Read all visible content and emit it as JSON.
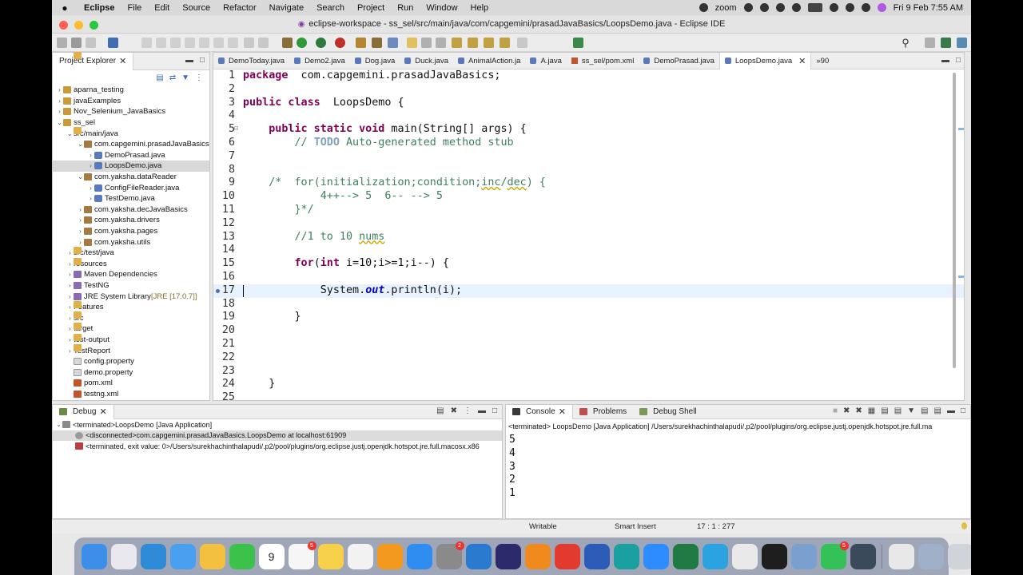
{
  "menubar": {
    "app": "Eclipse",
    "items": [
      "File",
      "Edit",
      "Source",
      "Refactor",
      "Navigate",
      "Search",
      "Project",
      "Run",
      "Window",
      "Help"
    ],
    "zoom": "zoom",
    "datetime": "Fri 9 Feb  7:55 AM"
  },
  "window": {
    "title": "eclipse-workspace - ss_sel/src/main/java/com/capgemini/prasadJavaBasics/LoopsDemo.java - Eclipse IDE"
  },
  "project_explorer": {
    "tab_label": "Project Explorer",
    "items": [
      {
        "label": "aparna_testing",
        "level": 0,
        "twisty": ">",
        "icon": "proj"
      },
      {
        "label": "javaExamples",
        "level": 0,
        "twisty": ">",
        "icon": "proj"
      },
      {
        "label": "Nov_Selenium_JavaBasics",
        "level": 0,
        "twisty": ">",
        "icon": "proj"
      },
      {
        "label": "ss_sel",
        "level": 0,
        "twisty": "v",
        "icon": "proj"
      },
      {
        "label": "src/main/java",
        "level": 1,
        "twisty": "v",
        "icon": "fold"
      },
      {
        "label": "com.capgemini.prasadJavaBasics",
        "level": 2,
        "twisty": "v",
        "icon": "pkg"
      },
      {
        "label": "DemoPrasad.java",
        "level": 3,
        "twisty": ">",
        "icon": "java"
      },
      {
        "label": "LoopsDemo.java",
        "level": 3,
        "twisty": ">",
        "icon": "java",
        "selected": true
      },
      {
        "label": "com.yaksha.dataReader",
        "level": 2,
        "twisty": "v",
        "icon": "pkg"
      },
      {
        "label": "ConfigFileReader.java",
        "level": 3,
        "twisty": ">",
        "icon": "java"
      },
      {
        "label": "TestDemo.java",
        "level": 3,
        "twisty": ">",
        "icon": "java"
      },
      {
        "label": "com.yaksha.decJavaBasics",
        "level": 2,
        "twisty": ">",
        "icon": "pkg"
      },
      {
        "label": "com.yaksha.drivers",
        "level": 2,
        "twisty": ">",
        "icon": "pkg"
      },
      {
        "label": "com.yaksha.pages",
        "level": 2,
        "twisty": ">",
        "icon": "pkg"
      },
      {
        "label": "com.yaksha.utils",
        "level": 2,
        "twisty": ">",
        "icon": "pkg"
      },
      {
        "label": "src/test/java",
        "level": 1,
        "twisty": ">",
        "icon": "fold"
      },
      {
        "label": "resources",
        "level": 1,
        "twisty": ">",
        "icon": "fold"
      },
      {
        "label": "Maven Dependencies",
        "level": 1,
        "twisty": ">",
        "icon": "lib"
      },
      {
        "label": "TestNG",
        "level": 1,
        "twisty": ">",
        "icon": "lib"
      },
      {
        "label": "JRE System Library",
        "suffix": "[JRE [17.0.7]]",
        "level": 1,
        "twisty": ">",
        "icon": "lib"
      },
      {
        "label": "Features",
        "level": 1,
        "twisty": ">",
        "icon": "fold"
      },
      {
        "label": "src",
        "level": 1,
        "twisty": ">",
        "icon": "fold"
      },
      {
        "label": "target",
        "level": 1,
        "twisty": ">",
        "icon": "fold"
      },
      {
        "label": "test-output",
        "level": 1,
        "twisty": ">",
        "icon": "fold"
      },
      {
        "label": "TestReport",
        "level": 1,
        "twisty": ">",
        "icon": "fold"
      },
      {
        "label": "config.property",
        "level": 1,
        "twisty": "",
        "icon": "file"
      },
      {
        "label": "demo.property",
        "level": 1,
        "twisty": "",
        "icon": "file"
      },
      {
        "label": "pom.xml",
        "level": 1,
        "twisty": "",
        "icon": "xml"
      },
      {
        "label": "testng.xml",
        "level": 1,
        "twisty": "",
        "icon": "xml"
      }
    ]
  },
  "editor": {
    "tabs": [
      {
        "label": "DemoToday.java",
        "icon": "java"
      },
      {
        "label": "Demo2.java",
        "icon": "java"
      },
      {
        "label": "Dog.java",
        "icon": "java"
      },
      {
        "label": "Duck.java",
        "icon": "java"
      },
      {
        "label": "AnimalAction.ja",
        "icon": "java"
      },
      {
        "label": "A.java",
        "icon": "java"
      },
      {
        "label": "ss_sel/pom.xml",
        "icon": "xml"
      },
      {
        "label": "DemoPrasad.java",
        "icon": "java"
      },
      {
        "label": "LoopsDemo.java",
        "icon": "java",
        "active": true
      }
    ],
    "overflow": "»90",
    "cursor_line": 17,
    "lines": [
      {
        "n": "1",
        "segs": [
          [
            "k",
            "package"
          ],
          [
            "",
            "  com.capgemini.prasadJavaBasics;"
          ]
        ]
      },
      {
        "n": "2",
        "segs": []
      },
      {
        "n": "3",
        "segs": [
          [
            "k",
            "public class"
          ],
          [
            "",
            "  LoopsDemo {"
          ]
        ]
      },
      {
        "n": "4",
        "segs": []
      },
      {
        "n": "5",
        "fold": true,
        "segs": [
          [
            "",
            "    "
          ],
          [
            "k",
            "public static void"
          ],
          [
            "",
            " main(String[] args) {"
          ]
        ]
      },
      {
        "n": "6",
        "segs": [
          [
            "",
            "        "
          ],
          [
            "c",
            "// "
          ],
          [
            "t",
            "TODO"
          ],
          [
            "c",
            " Auto-generated method stub"
          ]
        ]
      },
      {
        "n": "7",
        "segs": []
      },
      {
        "n": "8",
        "segs": []
      },
      {
        "n": "9",
        "segs": [
          [
            "",
            "    "
          ],
          [
            "c",
            "/*  for(initialization;condition;"
          ],
          [
            "cu",
            "inc"
          ],
          [
            "c",
            "/"
          ],
          [
            "cu",
            "dec"
          ],
          [
            "c",
            ") {"
          ]
        ]
      },
      {
        "n": "10",
        "segs": [
          [
            "c",
            "            4++--> 5  6-- --> 5"
          ]
        ]
      },
      {
        "n": "11",
        "segs": [
          [
            "c",
            "        }*/"
          ]
        ]
      },
      {
        "n": "12",
        "segs": []
      },
      {
        "n": "13",
        "segs": [
          [
            "",
            "        "
          ],
          [
            "c",
            "//1 to 10 "
          ],
          [
            "cu",
            "nums"
          ]
        ]
      },
      {
        "n": "14",
        "segs": []
      },
      {
        "n": "15",
        "segs": [
          [
            "",
            "        "
          ],
          [
            "k",
            "for"
          ],
          [
            "",
            "("
          ],
          [
            "k",
            "int"
          ],
          [
            "",
            " i=10;i>=1;i--) {"
          ]
        ]
      },
      {
        "n": "16",
        "segs": []
      },
      {
        "n": "17",
        "bp": true,
        "segs": [
          [
            "",
            "            System."
          ],
          [
            "fi",
            "out"
          ],
          [
            "",
            ".println(i);"
          ]
        ]
      },
      {
        "n": "18",
        "segs": []
      },
      {
        "n": "19",
        "segs": [
          [
            "",
            "        }"
          ]
        ]
      },
      {
        "n": "20",
        "segs": []
      },
      {
        "n": "21",
        "segs": []
      },
      {
        "n": "22",
        "segs": []
      },
      {
        "n": "23",
        "segs": []
      },
      {
        "n": "24",
        "segs": [
          [
            "",
            "    }"
          ]
        ]
      },
      {
        "n": "25",
        "segs": []
      }
    ]
  },
  "debug": {
    "tab_label": "Debug",
    "rows": [
      "<terminated>LoopsDemo [Java Application]",
      "<disconnected>com.capgemini.prasadJavaBasics.LoopsDemo at localhost:61909",
      "<terminated, exit value: 0>/Users/surekhachinthalapudi/.p2/pool/plugins/org.eclipse.justj.openjdk.hotspot.jre.full.macosx.x86"
    ]
  },
  "console": {
    "tabs": [
      "Console",
      "Problems",
      "Debug Shell"
    ],
    "header": "<terminated> LoopsDemo [Java Application] /Users/surekhachinthalapudi/.p2/pool/plugins/org.eclipse.justj.openjdk.hotspot.jre.full.ma",
    "output": [
      "5",
      "4",
      "3",
      "2",
      "1"
    ]
  },
  "status": {
    "writable": "Writable",
    "insert_mode": "Smart Insert",
    "position": "17 : 1 : 277"
  },
  "dock": {
    "apps": [
      {
        "name": "finder",
        "color": "#3d8ee8"
      },
      {
        "name": "launchpad",
        "color": "#e8e8ee"
      },
      {
        "name": "safari",
        "color": "#2f8ad8"
      },
      {
        "name": "mail",
        "color": "#4aa0f0"
      },
      {
        "name": "photos",
        "color": "#f4c040"
      },
      {
        "name": "facetime",
        "color": "#3cc24a"
      },
      {
        "name": "calendar",
        "color": "#ffffff",
        "label": "9"
      },
      {
        "name": "reminders",
        "color": "#f6f6f6",
        "badge": "5"
      },
      {
        "name": "notes",
        "color": "#f7d04a"
      },
      {
        "name": "freeform",
        "color": "#f2f2f2"
      },
      {
        "name": "pages",
        "color": "#f39a1e"
      },
      {
        "name": "app-store",
        "color": "#2f8cf0"
      },
      {
        "name": "system-settings",
        "color": "#8a8a8a",
        "badge": "2"
      },
      {
        "name": "vscode",
        "color": "#2a7ad0"
      },
      {
        "name": "eclipse",
        "color": "#2c2a6a"
      },
      {
        "name": "vlc",
        "color": "#f08a1c"
      },
      {
        "name": "anydesk",
        "color": "#e33a30"
      },
      {
        "name": "word",
        "color": "#2b5cb8"
      },
      {
        "name": "teamviewer",
        "color": "#1aa0a0"
      },
      {
        "name": "zoom",
        "color": "#2d8cff"
      },
      {
        "name": "excel",
        "color": "#1f7a44"
      },
      {
        "name": "telegram",
        "color": "#2aa3e0"
      },
      {
        "name": "chrome",
        "color": "#e9e9e9"
      },
      {
        "name": "terminal",
        "color": "#1e1e1e"
      },
      {
        "name": "preview",
        "color": "#7aa0d0"
      },
      {
        "name": "whatsapp",
        "color": "#33c158",
        "badge": "5"
      },
      {
        "name": "quicktime",
        "color": "#3a4a5a"
      },
      {
        "name": "document",
        "color": "#e8e8e8"
      },
      {
        "name": "downloads",
        "color": "#9fb0c8"
      },
      {
        "name": "trash",
        "color": "#d0d4da"
      }
    ]
  }
}
